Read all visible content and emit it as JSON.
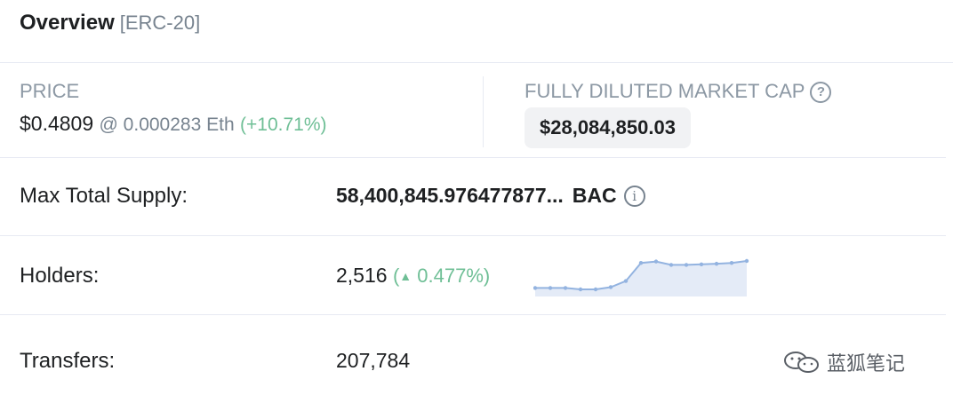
{
  "header": {
    "title": "Overview",
    "tag": "[ERC-20]"
  },
  "price": {
    "label": "PRICE",
    "usd": "$0.4809",
    "eth": "@ 0.000283 Eth",
    "change": "(+10.71%)"
  },
  "market_cap": {
    "label": "FULLY DILUTED MARKET CAP",
    "help_icon": "question-circle-icon",
    "help_glyph": "?",
    "value": "$28,084,850.03"
  },
  "rows": {
    "max_supply": {
      "label": "Max Total Supply:",
      "value": "58,400,845.976477877...",
      "unit": "BAC",
      "info_icon": "info-circle-icon",
      "info_glyph": "i"
    },
    "holders": {
      "label": "Holders:",
      "value": "2,516",
      "change_open": "(",
      "change_arrow": "▲",
      "change_value": "0.477%)",
      "sparkline": [
        0.05,
        0.05,
        0.05,
        0.0,
        0.0,
        0.08,
        0.3,
        0.95,
        1.0,
        0.88,
        0.88,
        0.9,
        0.92,
        0.95,
        1.02
      ]
    },
    "transfers": {
      "label": "Transfers:",
      "value": "207,784"
    }
  },
  "watermark": {
    "icon": "wechat-icon",
    "text": "蓝狐笔记"
  },
  "colors": {
    "positive": "#6fbf96",
    "sparkline_line": "#93b3e0",
    "sparkline_fill": "#e4ebf7",
    "divider": "#e7eaf3",
    "badge_bg": "#f1f2f4"
  }
}
